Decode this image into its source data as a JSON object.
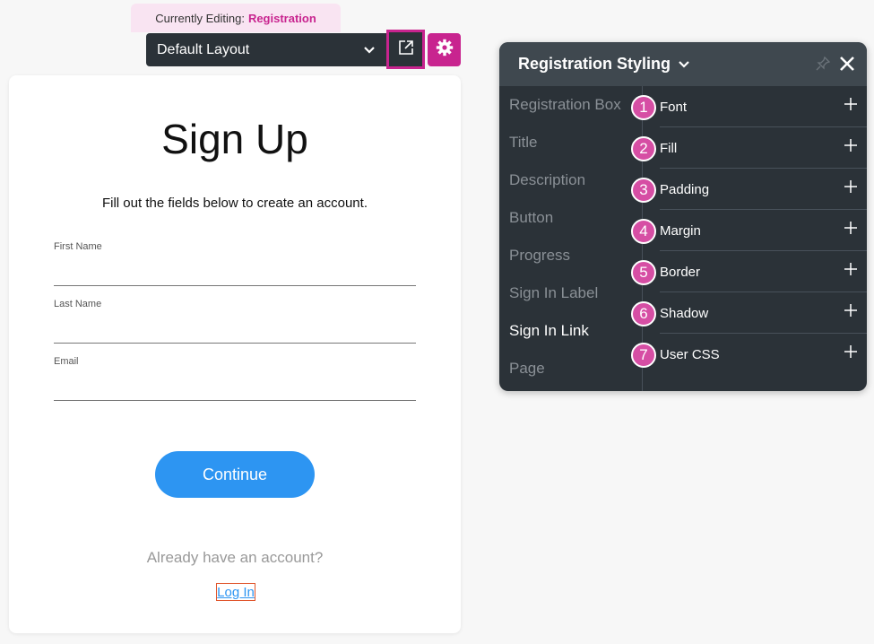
{
  "banner": {
    "prefix": "Currently Editing:",
    "target": "Registration"
  },
  "layout": {
    "selected": "Default Layout"
  },
  "card": {
    "title": "Sign Up",
    "description": "Fill out the fields below to create an account.",
    "fields": [
      {
        "label": "First Name",
        "value": ""
      },
      {
        "label": "Last Name",
        "value": ""
      },
      {
        "label": "Email",
        "value": ""
      }
    ],
    "continue_label": "Continue",
    "already_text": "Already have an account?",
    "login_label": "Log In"
  },
  "panel": {
    "title": "Registration Styling",
    "left_items": [
      {
        "label": "Registration Box",
        "active": false
      },
      {
        "label": "Title",
        "active": false
      },
      {
        "label": "Description",
        "active": false
      },
      {
        "label": "Button",
        "active": false
      },
      {
        "label": "Progress",
        "active": false
      },
      {
        "label": "Sign In Label",
        "active": false
      },
      {
        "label": "Sign In Link",
        "active": true
      },
      {
        "label": "Page",
        "active": false
      }
    ],
    "right_items": [
      {
        "label": "Font",
        "badge": "1"
      },
      {
        "label": "Fill",
        "badge": "2"
      },
      {
        "label": "Padding",
        "badge": "3"
      },
      {
        "label": "Margin",
        "badge": "4"
      },
      {
        "label": "Border",
        "badge": "5"
      },
      {
        "label": "Shadow",
        "badge": "6"
      },
      {
        "label": "User CSS",
        "badge": "7"
      }
    ]
  },
  "colors": {
    "accent": "#c8248f",
    "primary": "#2d95f2",
    "panel_bg": "#2b3238",
    "badge": "#d64ea4"
  }
}
